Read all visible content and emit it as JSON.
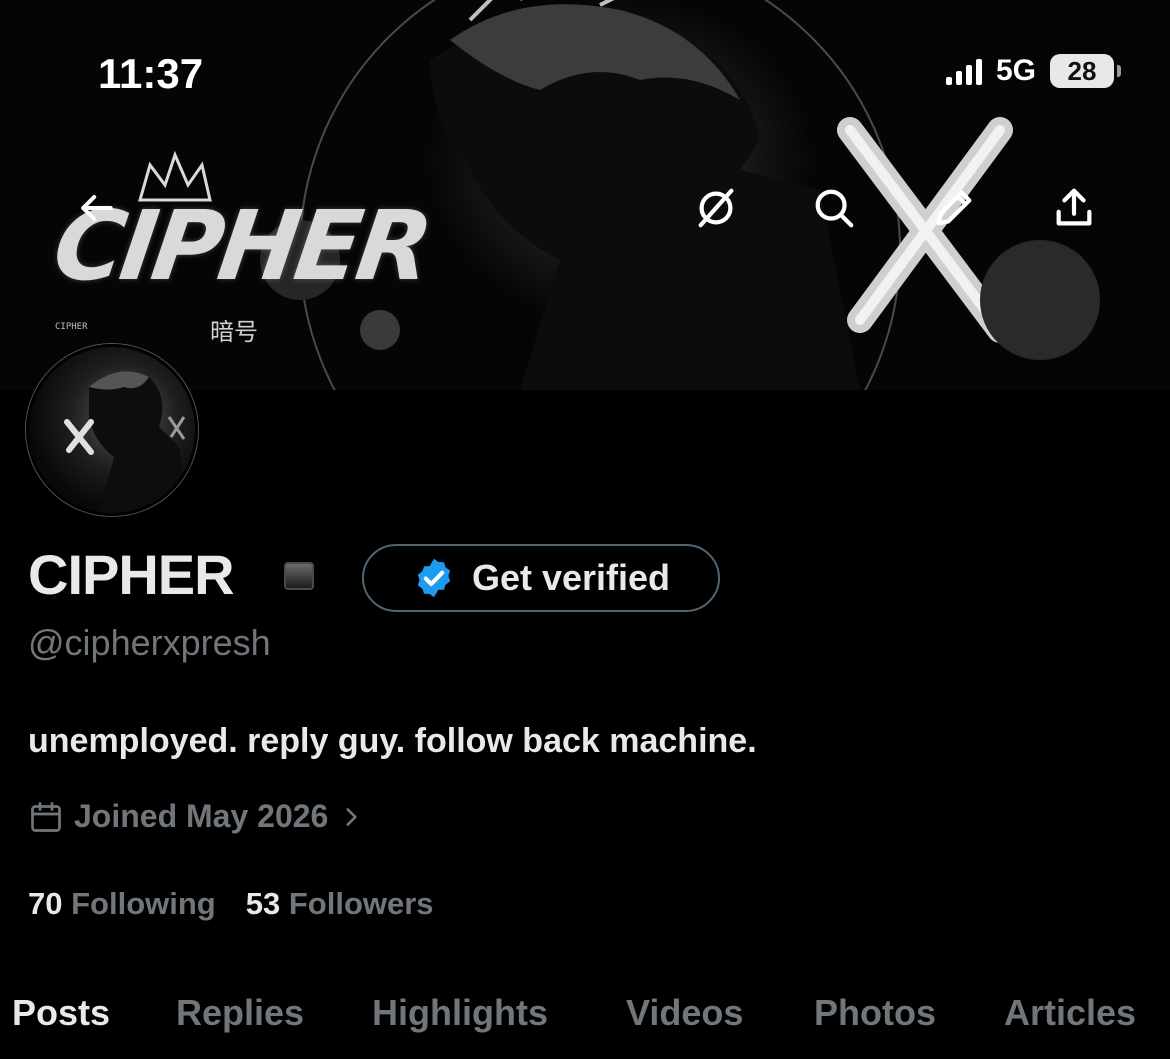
{
  "status_bar": {
    "time": "11:37",
    "network": "5G",
    "battery": "28"
  },
  "banner": {
    "logo_text": "CIPHER",
    "kanji": "暗号",
    "small_text": "CIPHER"
  },
  "header_icons": [
    "back-icon",
    "grok-icon",
    "search-icon",
    "edit-icon",
    "share-icon"
  ],
  "profile": {
    "display_name": "CIPHER",
    "handle": "@cipherxpresh",
    "bio": "unemployed. reply guy. follow back machine.",
    "joined": "Joined May 2026"
  },
  "verify_button": {
    "label": "Get verified",
    "badge_color": "#1d9bf0"
  },
  "stats": {
    "following_count": "70",
    "following_label": "Following",
    "followers_count": "53",
    "followers_label": "Followers"
  },
  "tabs": [
    "Posts",
    "Replies",
    "Highlights",
    "Videos",
    "Photos",
    "Articles"
  ],
  "active_tab": "Posts",
  "colors": {
    "background": "#000000",
    "text_primary": "#e7e9ea",
    "text_secondary": "#71767b",
    "border": "#536471"
  }
}
